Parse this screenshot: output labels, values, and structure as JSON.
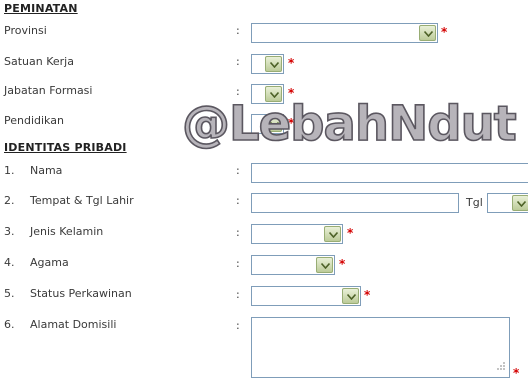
{
  "peminatan": {
    "title": "PEMINATAN",
    "provinsi": {
      "label": "Provinsi"
    },
    "satuan_kerja": {
      "label": "Satuan Kerja"
    },
    "jabatan_formasi": {
      "label": "Jabatan Formasi"
    },
    "pendidikan": {
      "label": "Pendidikan"
    }
  },
  "identitas": {
    "title": "IDENTITAS PRIBADI",
    "nama": {
      "num": "1.",
      "label": "Nama"
    },
    "ttl": {
      "num": "2.",
      "label": "Tempat & Tgl Lahir",
      "tgl_label": "Tgl"
    },
    "jenis_kelamin": {
      "num": "3.",
      "label": "Jenis Kelamin"
    },
    "agama": {
      "num": "4.",
      "label": "Agama"
    },
    "status": {
      "num": "5.",
      "label": "Status Perkawinan"
    },
    "alamat": {
      "num": "6.",
      "label": "Alamat Domisili"
    }
  },
  "colon": ":",
  "required_mark": "*",
  "watermark": "@LebahNdut",
  "colors": {
    "required": "#d40000",
    "border": "#7f9db9",
    "arrow_bg": "#c9d6ac"
  }
}
